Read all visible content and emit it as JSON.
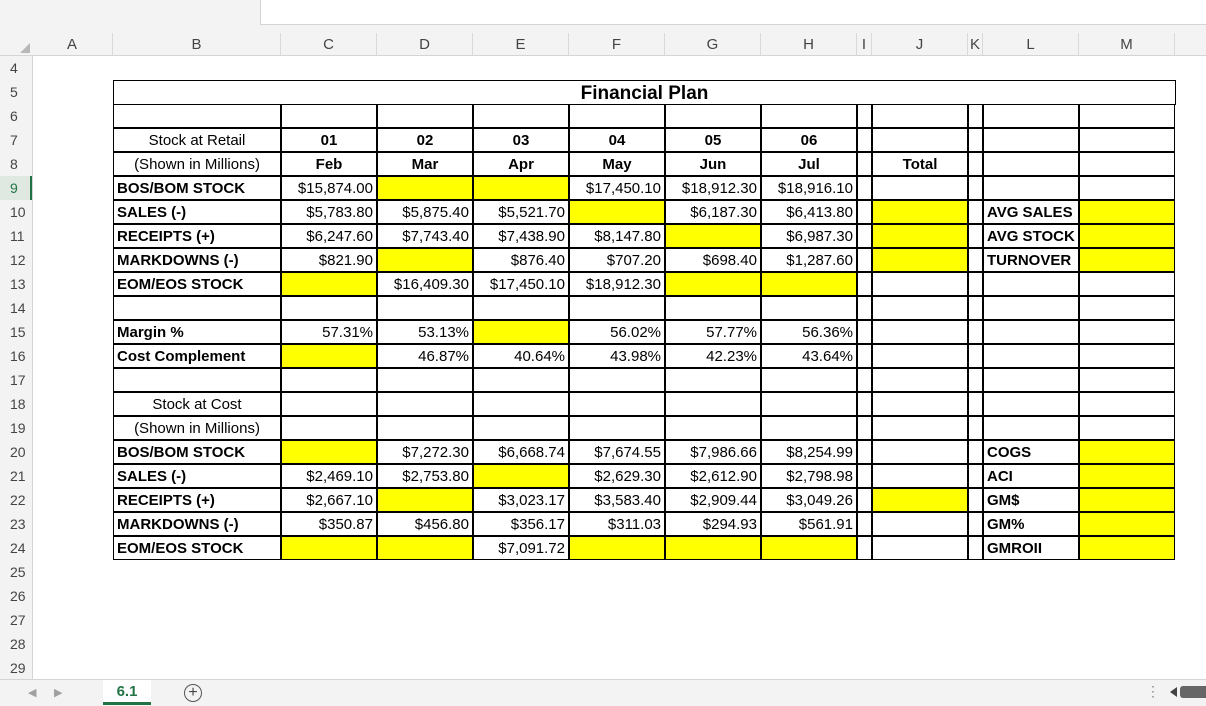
{
  "sheet": {
    "title": "Financial Plan",
    "active_row": "9",
    "columns": [
      "A",
      "B",
      "C",
      "D",
      "E",
      "F",
      "G",
      "H",
      "I",
      "J",
      "K",
      "L",
      "M"
    ],
    "rows": [
      "4",
      "5",
      "6",
      "7",
      "8",
      "9",
      "10",
      "11",
      "12",
      "13",
      "14",
      "15",
      "16",
      "17",
      "18",
      "19",
      "20",
      "21",
      "22",
      "23",
      "24",
      "25",
      "26",
      "27",
      "28",
      "29"
    ],
    "period_numbers": [
      "01",
      "02",
      "03",
      "04",
      "05",
      "06"
    ],
    "months": [
      "Feb",
      "Mar",
      "Apr",
      "May",
      "Jun",
      "Jul"
    ],
    "total_label": "Total",
    "retail_section": {
      "header_line1": "Stock at Retail",
      "header_line2": "(Shown in Millions)",
      "rows": [
        {
          "label": "BOS/BOM STOCK",
          "values": [
            "$15,874.00",
            "",
            "",
            "$17,450.10",
            "$18,912.30",
            "$18,916.10"
          ],
          "yellow": [
            false,
            true,
            true,
            false,
            false,
            false
          ],
          "total": "",
          "total_yellow": false
        },
        {
          "label": "SALES (-)",
          "values": [
            "$5,783.80",
            "$5,875.40",
            "$5,521.70",
            "",
            "$6,187.30",
            "$6,413.80"
          ],
          "yellow": [
            false,
            false,
            false,
            true,
            false,
            false
          ],
          "total": "",
          "total_yellow": true
        },
        {
          "label": "RECEIPTS (+)",
          "values": [
            "$6,247.60",
            "$7,743.40",
            "$7,438.90",
            "$8,147.80",
            "",
            "$6,987.30"
          ],
          "yellow": [
            false,
            false,
            false,
            false,
            true,
            false
          ],
          "total": "",
          "total_yellow": true
        },
        {
          "label": "MARKDOWNS (-)",
          "values": [
            "$821.90",
            "",
            "$876.40",
            "$707.20",
            "$698.40",
            "$1,287.60"
          ],
          "yellow": [
            false,
            true,
            false,
            false,
            false,
            false
          ],
          "total": "",
          "total_yellow": true
        },
        {
          "label": "EOM/EOS STOCK",
          "values": [
            "",
            "$16,409.30",
            "$17,450.10",
            "$18,912.30",
            "",
            ""
          ],
          "yellow": [
            true,
            false,
            false,
            false,
            true,
            true
          ],
          "total": "",
          "total_yellow": false
        }
      ]
    },
    "margin_section": {
      "rows": [
        {
          "label": "Margin %",
          "values": [
            "57.31%",
            "53.13%",
            "",
            "56.02%",
            "57.77%",
            "56.36%"
          ],
          "yellow": [
            false,
            false,
            true,
            false,
            false,
            false
          ]
        },
        {
          "label": "Cost Complement",
          "values": [
            "",
            "46.87%",
            "40.64%",
            "43.98%",
            "42.23%",
            "43.64%"
          ],
          "yellow": [
            true,
            false,
            false,
            false,
            false,
            false
          ]
        }
      ]
    },
    "cost_section": {
      "header_line1": "Stock at Cost",
      "header_line2": "(Shown in Millions)",
      "rows": [
        {
          "label": "BOS/BOM STOCK",
          "values": [
            "",
            "$7,272.30",
            "$6,668.74",
            "$7,674.55",
            "$7,986.66",
            "$8,254.99"
          ],
          "yellow": [
            true,
            false,
            false,
            false,
            false,
            false
          ],
          "total": "",
          "total_yellow": false
        },
        {
          "label": "SALES (-)",
          "values": [
            "$2,469.10",
            "$2,753.80",
            "",
            "$2,629.30",
            "$2,612.90",
            "$2,798.98"
          ],
          "yellow": [
            false,
            false,
            true,
            false,
            false,
            false
          ],
          "total": "",
          "total_yellow": false
        },
        {
          "label": "RECEIPTS (+)",
          "values": [
            "$2,667.10",
            "",
            "$3,023.17",
            "$3,583.40",
            "$2,909.44",
            "$3,049.26"
          ],
          "yellow": [
            false,
            true,
            false,
            false,
            false,
            false
          ],
          "total": "",
          "total_yellow": true
        },
        {
          "label": "MARKDOWNS (-)",
          "values": [
            "$350.87",
            "$456.80",
            "$356.17",
            "$311.03",
            "$294.93",
            "$561.91"
          ],
          "yellow": [
            false,
            false,
            false,
            false,
            false,
            false
          ],
          "total": "",
          "total_yellow": false
        },
        {
          "label": "EOM/EOS STOCK",
          "values": [
            "",
            "",
            "$7,091.72",
            "",
            "",
            ""
          ],
          "yellow": [
            true,
            true,
            false,
            true,
            true,
            true
          ],
          "total": "",
          "total_yellow": false
        }
      ]
    },
    "retail_metrics": [
      "AVG SALES",
      "AVG STOCK",
      "TURNOVER"
    ],
    "cost_metrics": [
      "COGS",
      "ACI",
      "GM$",
      "GM%",
      "GMROII"
    ]
  },
  "bottom_bar": {
    "sheet_tab": "6.1",
    "add_sheet_icon": "plus-circle-icon",
    "options_icon": "vertical-dots-icon"
  },
  "colors": {
    "highlight": "#ffff00",
    "accent": "#217346",
    "header_bg": "#f3f3f3"
  }
}
